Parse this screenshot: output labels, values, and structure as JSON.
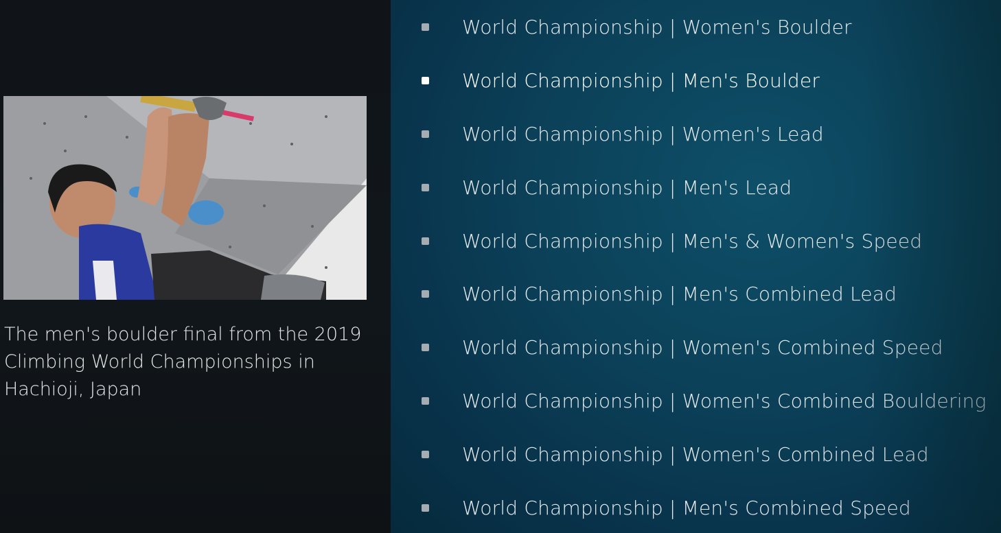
{
  "info_panel": {
    "caption": "The men's boulder final from the 2019 Climbing World Championships in Hachioji, Japan"
  },
  "video_list": {
    "focused_index": 1,
    "items": [
      {
        "label": "World Championship | Women's Boulder"
      },
      {
        "label": "World Championship | Men's Boulder"
      },
      {
        "label": "World Championship | Women's Lead"
      },
      {
        "label": "World Championship | Men's Lead"
      },
      {
        "label": "World Championship | Men's & Women's Speed"
      },
      {
        "label": "World Championship | Men's Combined Lead"
      },
      {
        "label": "World Championship | Women's Combined Speed"
      },
      {
        "label": "World Championship | Women's Combined Bouldering"
      },
      {
        "label": "World Championship | Women's Combined Lead"
      },
      {
        "label": "World Championship | Men's Combined Speed"
      }
    ]
  },
  "colors": {
    "left_bg": "#101418",
    "right_bg": "#0b4058",
    "bullet": "#a6adb2",
    "bullet_focused": "#ffffff",
    "text": "#e8ecef"
  }
}
